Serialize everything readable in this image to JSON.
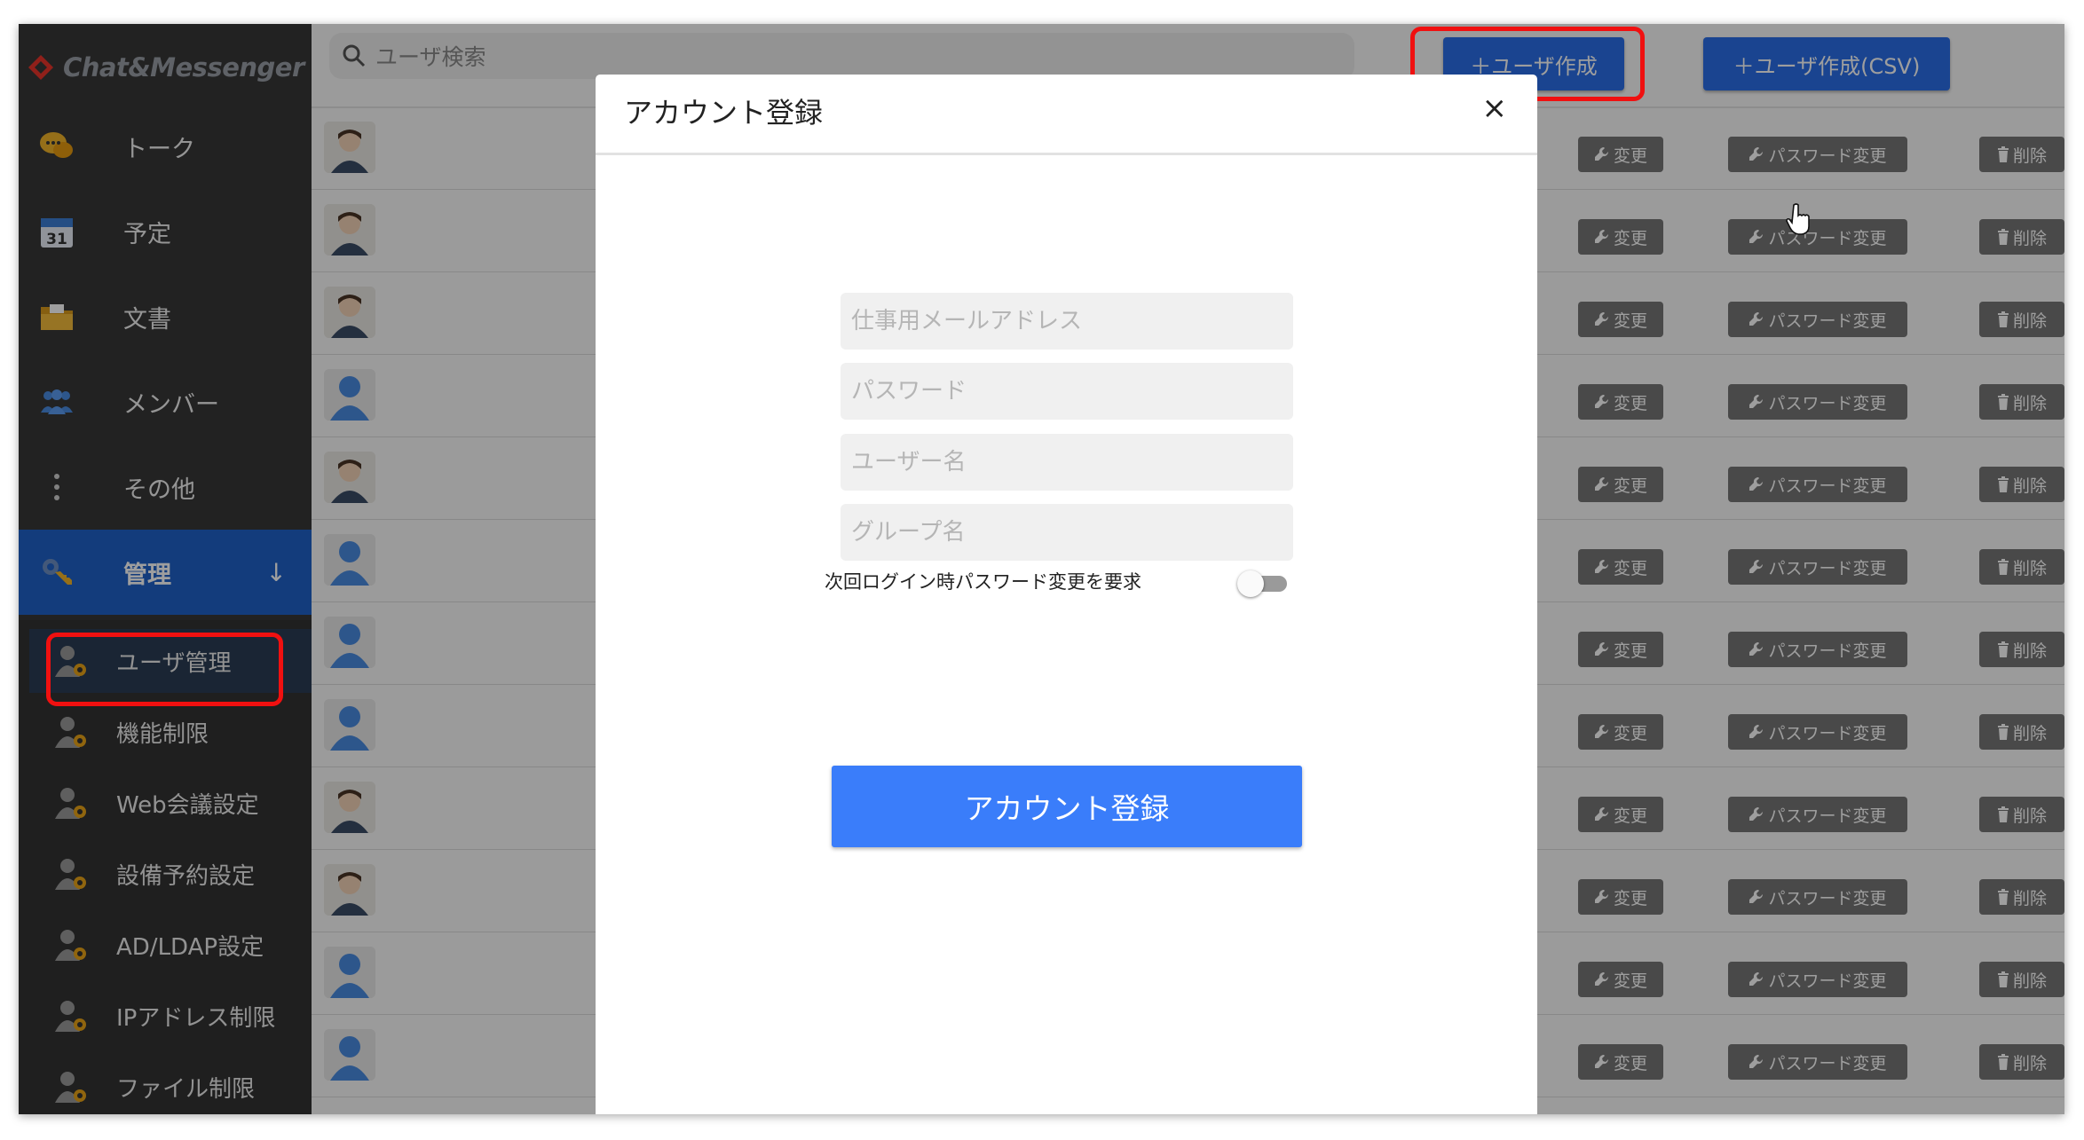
{
  "app": {
    "logo_text": "Chat&Messenger"
  },
  "sidebar": {
    "nav": [
      {
        "label": "トーク",
        "icon": "chat-bubbles-icon"
      },
      {
        "label": "予定",
        "icon": "calendar-icon"
      },
      {
        "label": "文書",
        "icon": "folder-icon"
      },
      {
        "label": "メンバー",
        "icon": "members-icon"
      },
      {
        "label": "その他",
        "icon": "more-vertical-icon"
      },
      {
        "label": "管理",
        "icon": "admin-key-icon"
      }
    ],
    "admin_items": [
      {
        "label": "ユーザ管理"
      },
      {
        "label": "機能制限"
      },
      {
        "label": "Web会議設定"
      },
      {
        "label": "設備予約設定"
      },
      {
        "label": "AD/LDAP設定"
      },
      {
        "label": "IPアドレス制限"
      },
      {
        "label": "ファイル制限"
      }
    ]
  },
  "toolbar": {
    "search_placeholder": "ユーザ検索",
    "create_user_label": "＋ユーザ作成",
    "create_user_csv_label": "＋ユーザ作成(CSV)"
  },
  "user_rows": {
    "edit_label": "変更",
    "password_label": "パスワード変更",
    "delete_label": "削除",
    "avatars": [
      "photo",
      "photo",
      "photo",
      "generic",
      "photo",
      "generic",
      "generic",
      "generic",
      "photo",
      "photo",
      "generic",
      "generic"
    ]
  },
  "modal": {
    "title": "アカウント登録",
    "close": "×",
    "email_placeholder": "仕事用メールアドレス",
    "password_placeholder": "パスワード",
    "username_placeholder": "ユーザー名",
    "group_placeholder": "グループ名",
    "toggle_label": "次回ログイン時パスワード変更を要求",
    "toggle_on": false,
    "submit_label": "アカウント登録"
  },
  "colors": {
    "primary": "#2a6ee8",
    "submit": "#3a7dfa",
    "highlight": "#f01010",
    "sidebar": "#383838",
    "active_nav": "#1f62c9"
  }
}
